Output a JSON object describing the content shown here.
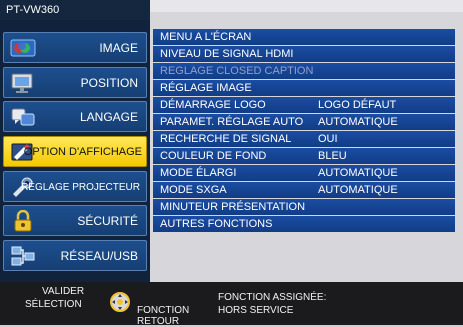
{
  "header": {
    "model": "PT-VW360"
  },
  "sidebar": {
    "items": [
      {
        "label": "IMAGE"
      },
      {
        "label": "POSITION"
      },
      {
        "label": "LANGAGE"
      },
      {
        "label": "OPTION D'AFFICHAGE",
        "active": true
      },
      {
        "label": "RÉGLAGE PROJECTEUR"
      },
      {
        "label": "SÉCURITÉ"
      },
      {
        "label": "RÉSEAU/USB"
      }
    ]
  },
  "menu": {
    "rows": [
      {
        "label": "MENU A L'ÉCRAN",
        "value": ""
      },
      {
        "label": "NIVEAU DE SIGNAL HDMI",
        "value": ""
      },
      {
        "label": "REGLAGE CLOSED CAPTION",
        "value": "",
        "disabled": true
      },
      {
        "label": "RÉGLAGE IMAGE",
        "value": ""
      },
      {
        "label": "DÉMARRAGE LOGO",
        "value": "LOGO DÉFAUT"
      },
      {
        "label": "PARAMET. RÉGLAGE AUTO",
        "value": "AUTOMATIQUE"
      },
      {
        "label": "RECHERCHE DE SIGNAL",
        "value": "OUI"
      },
      {
        "label": "COULEUR DE FOND",
        "value": "BLEU"
      },
      {
        "label": "MODE ÉLARGI",
        "value": "AUTOMATIQUE"
      },
      {
        "label": "MODE SXGA",
        "value": "AUTOMATIQUE"
      },
      {
        "label": "MINUTEUR PRÉSENTATION",
        "value": ""
      },
      {
        "label": "AUTRES FONCTIONS",
        "value": ""
      }
    ]
  },
  "footer": {
    "valider": "VALIDER",
    "selection": "SÉLECTION",
    "fonction": "FONCTION",
    "retour": "RETOUR",
    "assigned_label": "FONCTION ASSIGNÉE:",
    "assigned_value": "HORS SERVICE"
  },
  "colors": {
    "active_tab": "#f4c900",
    "row_blue": "#1a4da2",
    "sidebar_bg": "#10223c"
  }
}
